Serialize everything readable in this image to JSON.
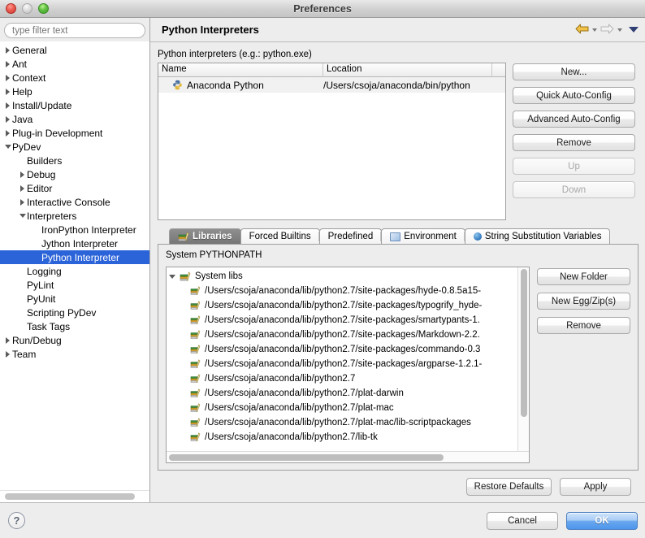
{
  "window": {
    "title": "Preferences",
    "controls": [
      "close-button",
      "minimize-button",
      "zoom-button"
    ]
  },
  "sidebar": {
    "filter_placeholder": "type filter text",
    "items": [
      {
        "label": "General",
        "indent": 0,
        "twisty": "right",
        "selected": false
      },
      {
        "label": "Ant",
        "indent": 0,
        "twisty": "right",
        "selected": false
      },
      {
        "label": "Context",
        "indent": 0,
        "twisty": "right",
        "selected": false
      },
      {
        "label": "Help",
        "indent": 0,
        "twisty": "right",
        "selected": false
      },
      {
        "label": "Install/Update",
        "indent": 0,
        "twisty": "right",
        "selected": false
      },
      {
        "label": "Java",
        "indent": 0,
        "twisty": "right",
        "selected": false
      },
      {
        "label": "Plug-in Development",
        "indent": 0,
        "twisty": "right",
        "selected": false
      },
      {
        "label": "PyDev",
        "indent": 0,
        "twisty": "down",
        "selected": false
      },
      {
        "label": "Builders",
        "indent": 1,
        "twisty": "none",
        "selected": false
      },
      {
        "label": "Debug",
        "indent": 1,
        "twisty": "right",
        "selected": false
      },
      {
        "label": "Editor",
        "indent": 1,
        "twisty": "right",
        "selected": false
      },
      {
        "label": "Interactive Console",
        "indent": 1,
        "twisty": "right",
        "selected": false
      },
      {
        "label": "Interpreters",
        "indent": 1,
        "twisty": "down",
        "selected": false
      },
      {
        "label": "IronPython Interpreter",
        "indent": 2,
        "twisty": "none",
        "selected": false
      },
      {
        "label": "Jython Interpreter",
        "indent": 2,
        "twisty": "none",
        "selected": false
      },
      {
        "label": "Python Interpreter",
        "indent": 2,
        "twisty": "none",
        "selected": true
      },
      {
        "label": "Logging",
        "indent": 1,
        "twisty": "none",
        "selected": false
      },
      {
        "label": "PyLint",
        "indent": 1,
        "twisty": "none",
        "selected": false
      },
      {
        "label": "PyUnit",
        "indent": 1,
        "twisty": "none",
        "selected": false
      },
      {
        "label": "Scripting PyDev",
        "indent": 1,
        "twisty": "none",
        "selected": false
      },
      {
        "label": "Task Tags",
        "indent": 1,
        "twisty": "none",
        "selected": false
      },
      {
        "label": "Run/Debug",
        "indent": 0,
        "twisty": "right",
        "selected": false
      },
      {
        "label": "Team",
        "indent": 0,
        "twisty": "right",
        "selected": false
      }
    ]
  },
  "main": {
    "page_title": "Python Interpreters",
    "nav": {
      "back": "back-arrow",
      "forward": "forward-arrow",
      "menu": "view-menu-chevron"
    },
    "interpreters_label": "Python interpreters (e.g.: python.exe)",
    "table": {
      "columns": [
        "Name",
        "Location",
        ""
      ],
      "rows": [
        {
          "name": "Anaconda Python",
          "location": "/Users/csoja/anaconda/bin/python"
        }
      ]
    },
    "side_buttons": [
      {
        "label": "New...",
        "enabled": true
      },
      {
        "label": "Quick Auto-Config",
        "enabled": true
      },
      {
        "label": "Advanced Auto-Config",
        "enabled": true
      },
      {
        "label": "Remove",
        "enabled": true
      },
      {
        "label": "Up",
        "enabled": false
      },
      {
        "label": "Down",
        "enabled": false
      }
    ],
    "tabs": [
      {
        "label": "Libraries",
        "icon": "books-icon",
        "active": true
      },
      {
        "label": "Forced Builtins",
        "icon": "",
        "active": false
      },
      {
        "label": "Predefined",
        "icon": "",
        "active": false
      },
      {
        "label": "Environment",
        "icon": "env-icon",
        "active": false
      },
      {
        "label": "String Substitution Variables",
        "icon": "blue-dot-icon",
        "active": false
      }
    ],
    "libraries": {
      "section_label": "System PYTHONPATH",
      "root": "System libs",
      "paths": [
        "/Users/csoja/anaconda/lib/python2.7/site-packages/hyde-0.8.5a15-",
        "/Users/csoja/anaconda/lib/python2.7/site-packages/typogrify_hyde-",
        "/Users/csoja/anaconda/lib/python2.7/site-packages/smartypants-1.",
        "/Users/csoja/anaconda/lib/python2.7/site-packages/Markdown-2.2.",
        "/Users/csoja/anaconda/lib/python2.7/site-packages/commando-0.3",
        "/Users/csoja/anaconda/lib/python2.7/site-packages/argparse-1.2.1-",
        "/Users/csoja/anaconda/lib/python2.7",
        "/Users/csoja/anaconda/lib/python2.7/plat-darwin",
        "/Users/csoja/anaconda/lib/python2.7/plat-mac",
        "/Users/csoja/anaconda/lib/python2.7/plat-mac/lib-scriptpackages",
        "/Users/csoja/anaconda/lib/python2.7/lib-tk"
      ],
      "buttons": [
        {
          "label": "New Folder",
          "enabled": true
        },
        {
          "label": "New Egg/Zip(s)",
          "enabled": true
        },
        {
          "label": "Remove",
          "enabled": true
        }
      ]
    },
    "apply_row": [
      {
        "label": "Restore Defaults",
        "enabled": true
      },
      {
        "label": "Apply",
        "enabled": true
      }
    ]
  },
  "footer": {
    "help": "?",
    "cancel": "Cancel",
    "ok": "OK"
  },
  "colors": {
    "selection_blue": "#2b63d9",
    "default_button_blue": "#4d95ec",
    "window_bg": "#ededed",
    "back_arrow_gold": "#e8b53a"
  }
}
